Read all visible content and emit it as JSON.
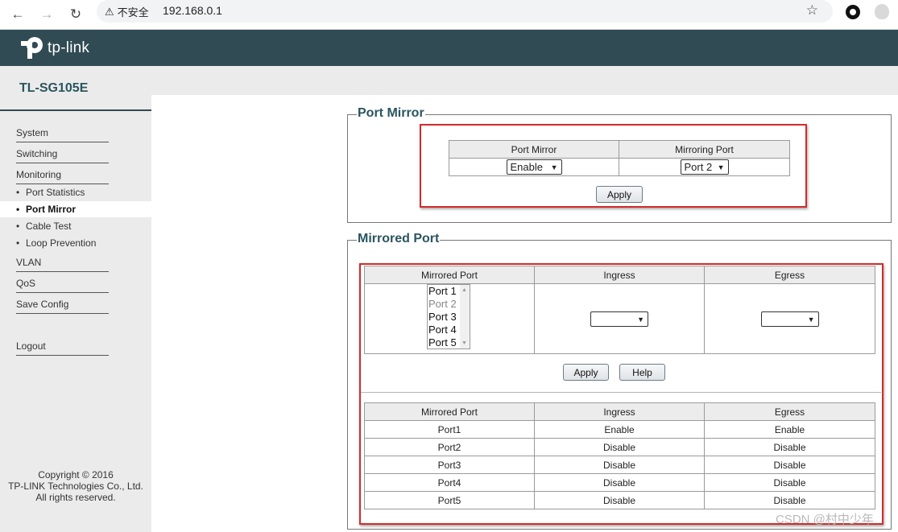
{
  "browser": {
    "security_label": "不安全",
    "url": "192.168.0.1"
  },
  "brand": {
    "logo_text": "tp-link",
    "model": "TL-SG105E"
  },
  "sidebar": {
    "items": [
      {
        "label": "System"
      },
      {
        "label": "Switching"
      },
      {
        "label": "Monitoring"
      },
      {
        "label": "VLAN"
      },
      {
        "label": "QoS"
      },
      {
        "label": "Save Config"
      },
      {
        "label": "Logout"
      }
    ],
    "monitoring_sub": [
      {
        "label": "Port Statistics"
      },
      {
        "label": "Port Mirror",
        "active": true
      },
      {
        "label": "Cable Test"
      },
      {
        "label": "Loop Prevention"
      }
    ],
    "copyright": [
      "Copyright © 2016",
      "TP-LINK Technologies Co., Ltd.",
      "All rights reserved."
    ]
  },
  "port_mirror": {
    "legend": "Port Mirror",
    "headers": [
      "Port Mirror",
      "Mirroring Port"
    ],
    "mirror_value": "Enable",
    "mirroring_port_value": "Port 2",
    "apply_label": "Apply"
  },
  "mirrored_port": {
    "legend": "Mirrored Port",
    "headers": [
      "Mirrored Port",
      "Ingress",
      "Egress"
    ],
    "port_list": [
      "Port 1",
      "Port 2",
      "Port 3",
      "Port 4",
      "Port 5"
    ],
    "ingress_value": "",
    "egress_value": "",
    "apply_label": "Apply",
    "help_label": "Help",
    "status_headers": [
      "Mirrored Port",
      "Ingress",
      "Egress"
    ],
    "status_rows": [
      [
        "Port1",
        "Enable",
        "Enable"
      ],
      [
        "Port2",
        "Disable",
        "Disable"
      ],
      [
        "Port3",
        "Disable",
        "Disable"
      ],
      [
        "Port4",
        "Disable",
        "Disable"
      ],
      [
        "Port5",
        "Disable",
        "Disable"
      ]
    ]
  },
  "watermark": "CSDN @村中少年",
  "colors": {
    "header_bg": "#304b53",
    "accent_text": "#2a5560",
    "highlight_border": "#d42a2a"
  }
}
